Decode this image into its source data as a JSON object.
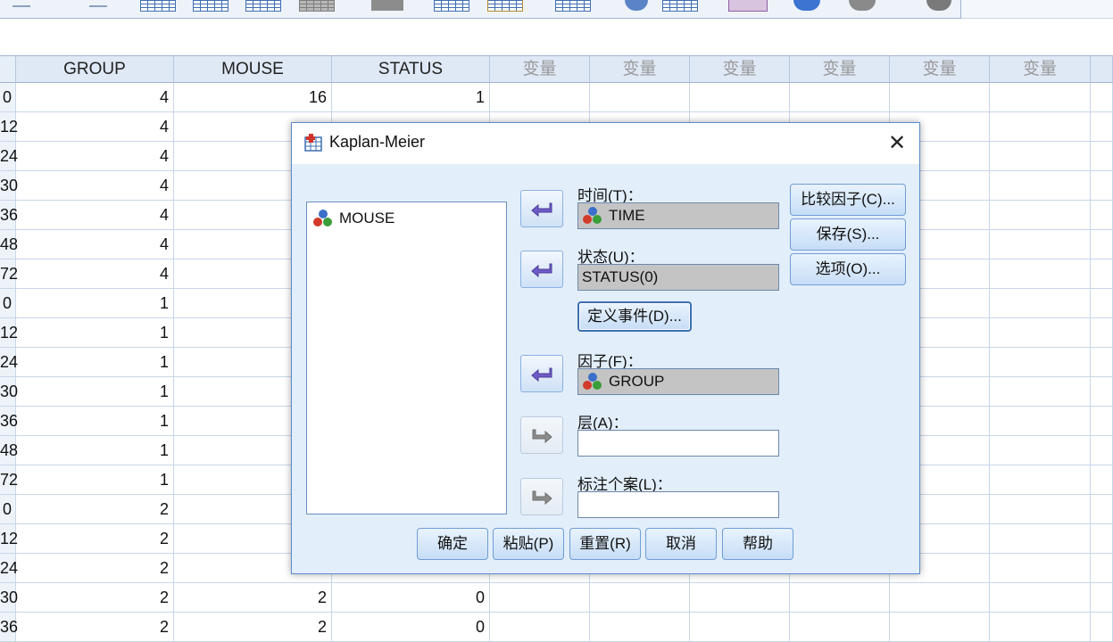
{
  "grid": {
    "headers": [
      "GROUP",
      "MOUSE",
      "STATUS",
      "变量",
      "变量",
      "变量",
      "变量",
      "变量",
      "变量"
    ],
    "rows": [
      {
        "n": "0",
        "group": "4",
        "mouse": "16",
        "status": "1"
      },
      {
        "n": "12",
        "group": "4",
        "mouse": "",
        "status": ""
      },
      {
        "n": "24",
        "group": "4",
        "mouse": "",
        "status": ""
      },
      {
        "n": "30",
        "group": "4",
        "mouse": "",
        "status": ""
      },
      {
        "n": "36",
        "group": "4",
        "mouse": "",
        "status": ""
      },
      {
        "n": "48",
        "group": "4",
        "mouse": "",
        "status": ""
      },
      {
        "n": "72",
        "group": "4",
        "mouse": "",
        "status": ""
      },
      {
        "n": "0",
        "group": "1",
        "mouse": "",
        "status": ""
      },
      {
        "n": "12",
        "group": "1",
        "mouse": "",
        "status": ""
      },
      {
        "n": "24",
        "group": "1",
        "mouse": "",
        "status": ""
      },
      {
        "n": "30",
        "group": "1",
        "mouse": "",
        "status": ""
      },
      {
        "n": "36",
        "group": "1",
        "mouse": "",
        "status": ""
      },
      {
        "n": "48",
        "group": "1",
        "mouse": "",
        "status": ""
      },
      {
        "n": "72",
        "group": "1",
        "mouse": "",
        "status": ""
      },
      {
        "n": "0",
        "group": "2",
        "mouse": "",
        "status": ""
      },
      {
        "n": "12",
        "group": "2",
        "mouse": "",
        "status": ""
      },
      {
        "n": "24",
        "group": "2",
        "mouse": "",
        "status": ""
      },
      {
        "n": "30",
        "group": "2",
        "mouse": "2",
        "status": "0"
      },
      {
        "n": "36",
        "group": "2",
        "mouse": "2",
        "status": "0"
      }
    ]
  },
  "dialog": {
    "title": "Kaplan-Meier",
    "close_label": "✕",
    "variables": [
      "MOUSE"
    ],
    "time_label": "时间(T)：",
    "time_value": "TIME",
    "status_label": "状态(U)：",
    "status_value": "STATUS(0)",
    "define_event_label": "定义事件(D)...",
    "factor_label": "因子(F)：",
    "factor_value": "GROUP",
    "strata_label": "层(A)：",
    "strata_value": "",
    "label_cases_label": "标注个案(L)：",
    "label_cases_value": "",
    "compare_factor_label": "比较因子(C)...",
    "save_label": "保存(S)...",
    "options_label": "选项(O)...",
    "ok_label": "确定",
    "paste_label": "粘贴(P)",
    "reset_label": "重置(R)",
    "cancel_label": "取消",
    "help_label": "帮助"
  }
}
